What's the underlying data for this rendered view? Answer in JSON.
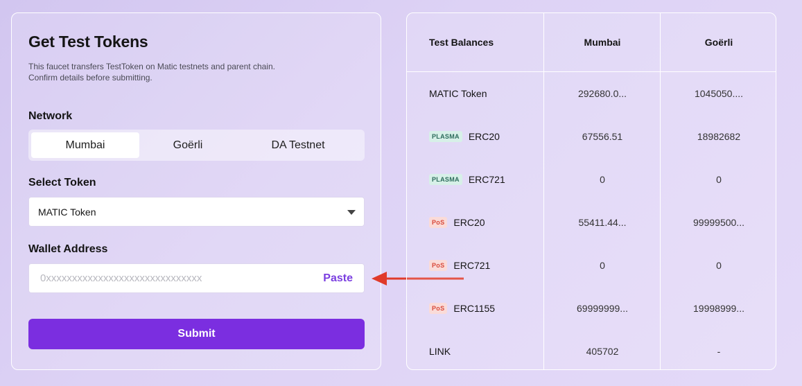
{
  "left": {
    "title": "Get Test Tokens",
    "description": "This faucet transfers TestToken on Matic testnets and parent chain. Confirm details before submitting.",
    "network_label": "Network",
    "networks": [
      "Mumbai",
      "Goërli",
      "DA Testnet"
    ],
    "selected_network": "Mumbai",
    "token_label": "Select Token",
    "selected_token": "MATIC Token",
    "wallet_label": "Wallet Address",
    "wallet_placeholder": "0xxxxxxxxxxxxxxxxxxxxxxxxxxxxxx",
    "wallet_value": "",
    "paste_label": "Paste",
    "submit_label": "Submit"
  },
  "balances": {
    "headers": [
      "Test Balances",
      "Mumbai",
      "Goërli"
    ],
    "rows": [
      {
        "badge": "",
        "name": "MATIC Token",
        "mumbai": "292680.0...",
        "goerli": "1045050...."
      },
      {
        "badge": "PLASMA",
        "name": "ERC20",
        "mumbai": "67556.51",
        "goerli": "18982682"
      },
      {
        "badge": "PLASMA",
        "name": "ERC721",
        "mumbai": "0",
        "goerli": "0"
      },
      {
        "badge": "PoS",
        "name": "ERC20",
        "mumbai": "55411.44...",
        "goerli": "99999500..."
      },
      {
        "badge": "PoS",
        "name": "ERC721",
        "mumbai": "0",
        "goerli": "0"
      },
      {
        "badge": "PoS",
        "name": "ERC1155",
        "mumbai": "69999999...",
        "goerli": "19998999..."
      },
      {
        "badge": "",
        "name": "LINK",
        "mumbai": "405702",
        "goerli": "-"
      }
    ]
  },
  "colors": {
    "accent": "#7b2ee0",
    "arrow": "#e03a2a",
    "plasma_badge_bg": "#d7f0e8",
    "pos_badge_bg": "#fadbd8"
  }
}
